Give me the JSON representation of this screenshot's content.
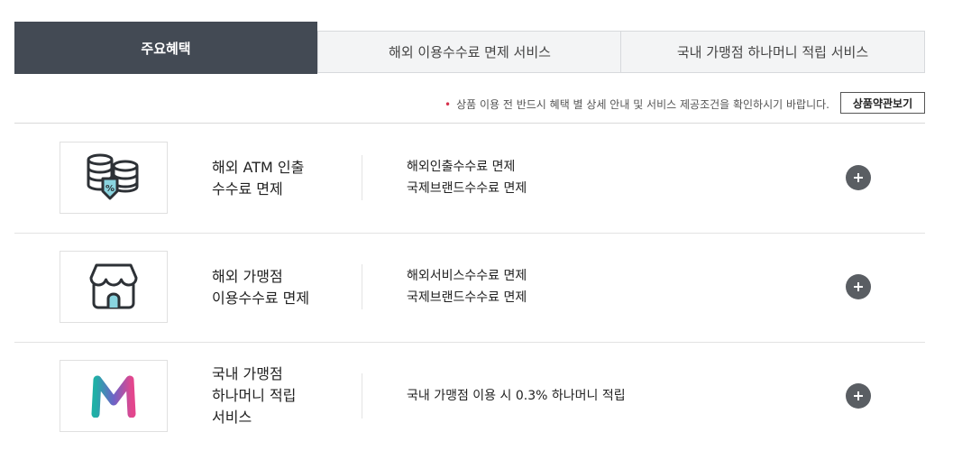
{
  "tabs": [
    {
      "label": "주요혜택",
      "active": true
    },
    {
      "label": "해외 이용수수료 면제 서비스",
      "active": false
    },
    {
      "label": "국내 가맹점 하나머니 적립 서비스",
      "active": false
    }
  ],
  "notice": {
    "bullet": "•",
    "text": "상품 이용 전 반드시 혜택 별 상세 안내 및 서비스 제공조건을 확인하시기 바랍니다.",
    "terms_button": "상품약관보기"
  },
  "benefits": [
    {
      "icon": "coins-discount-icon",
      "title_lines": [
        "해외 ATM 인출",
        "수수료 면제"
      ],
      "desc_lines": [
        "해외인출수수료 면제",
        "국제브랜드수수료 면제"
      ]
    },
    {
      "icon": "store-icon",
      "title_lines": [
        "해외 가맹점",
        "이용수수료 면제"
      ],
      "desc_lines": [
        "해외서비스수수료 면제",
        "국제브랜드수수료 면제"
      ]
    },
    {
      "icon": "hana-money-m-icon",
      "title_lines": [
        "국내 가맹점",
        "하나머니 적립",
        "서비스"
      ],
      "desc_lines": [
        "국내 가맹점 이용 시 0.3% 하나머니 적립"
      ]
    }
  ],
  "colors": {
    "active_tab": "#434a54",
    "notice_dot": "#d6304b",
    "icon_accent": "#8ad4df",
    "plus_button": "#5a5e63"
  }
}
